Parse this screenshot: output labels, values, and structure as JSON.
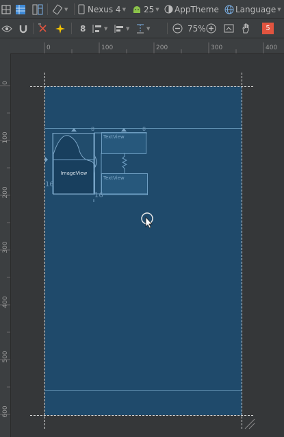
{
  "toolbar1": {
    "device": "Nexus 4",
    "api": "25",
    "theme": "AppTheme",
    "language": "Language"
  },
  "toolbar2": {
    "margin_value": "8",
    "zoom": "75%"
  },
  "ruler_top": {
    "labels": [
      "0",
      "100",
      "200",
      "300",
      "400"
    ]
  },
  "ruler_left": {
    "labels": [
      "0",
      "100",
      "200",
      "300",
      "400",
      "500",
      "600"
    ]
  },
  "canvas": {
    "imageview_label": "ImageView",
    "textview1_label": "TextView",
    "textview2_label": "TextView",
    "margin_label_left": "16",
    "margin_label_bottom": "16",
    "margin_label_top1": "8",
    "margin_label_top2": "8"
  },
  "colors": {
    "device_bg": "#1f4a6b",
    "toolbar_bg": "#3c3f41",
    "badge": "#e1543f"
  },
  "badge_count": "5"
}
